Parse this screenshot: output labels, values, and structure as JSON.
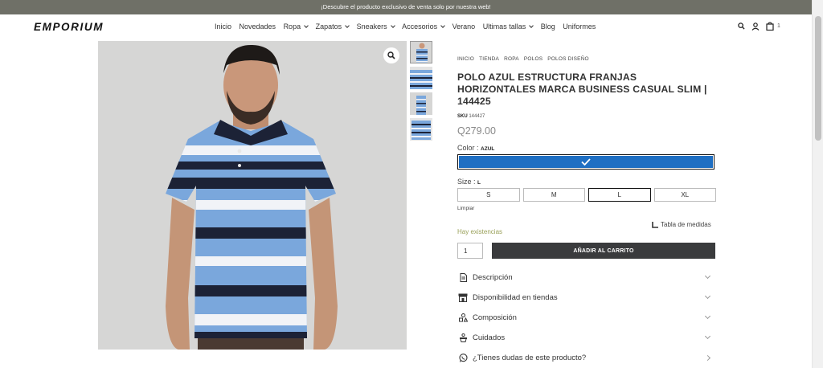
{
  "announcement": "¡Descubre el producto exclusivo de venta solo por nuestra web!",
  "header": {
    "logo": "EMPORIUM",
    "nav": [
      {
        "label": "Inicio",
        "dropdown": false
      },
      {
        "label": "Novedades",
        "dropdown": false
      },
      {
        "label": "Ropa",
        "dropdown": true
      },
      {
        "label": "Zapatos",
        "dropdown": true
      },
      {
        "label": "Sneakers",
        "dropdown": true
      },
      {
        "label": "Accesorios",
        "dropdown": true
      },
      {
        "label": "Verano",
        "dropdown": false
      },
      {
        "label": "Ultimas tallas",
        "dropdown": true
      },
      {
        "label": "Blog",
        "dropdown": false
      },
      {
        "label": "Uniformes",
        "dropdown": false
      }
    ],
    "cart_count": "1"
  },
  "breadcrumb": [
    "INICIO",
    "TIENDA",
    "ROPA",
    "POLOS",
    "POLOS DISEÑO"
  ],
  "product": {
    "title": "POLO AZUL ESTRUCTURA FRANJAS HORIZONTALES MARCA BUSINESS CASUAL SLIM | 144425",
    "sku_label": "SKU",
    "sku": "144427",
    "price": "Q279.00",
    "color_label": "Color",
    "color_value": "AZUL",
    "color_hex": "#1f6fc3",
    "size_label": "Size",
    "size_value": "L",
    "sizes": [
      "S",
      "M",
      "L",
      "XL"
    ],
    "selected_size": "L",
    "clear_label": "Limpiar",
    "measure_label": "Tabla de medidas",
    "stock": "Hay existencias",
    "qty": "1",
    "add_to_cart": "AÑADIR AL CARRITO"
  },
  "accordion": [
    {
      "label": "Descripción",
      "icon": "document-icon"
    },
    {
      "label": "Disponibilidad en tiendas",
      "icon": "store-icon"
    },
    {
      "label": "Composición",
      "icon": "shapes-icon"
    },
    {
      "label": "Cuidados",
      "icon": "washing-icon"
    },
    {
      "label": "¿Tienes dudas de este producto?",
      "icon": "whatsapp-icon"
    }
  ],
  "colors": {
    "stripe_blue": "#7aa7dc",
    "stripe_navy": "#1c2236",
    "stripe_white": "#f1f3f7",
    "button_dark": "#3a3b3d",
    "stock_green": "#9aa15a"
  }
}
